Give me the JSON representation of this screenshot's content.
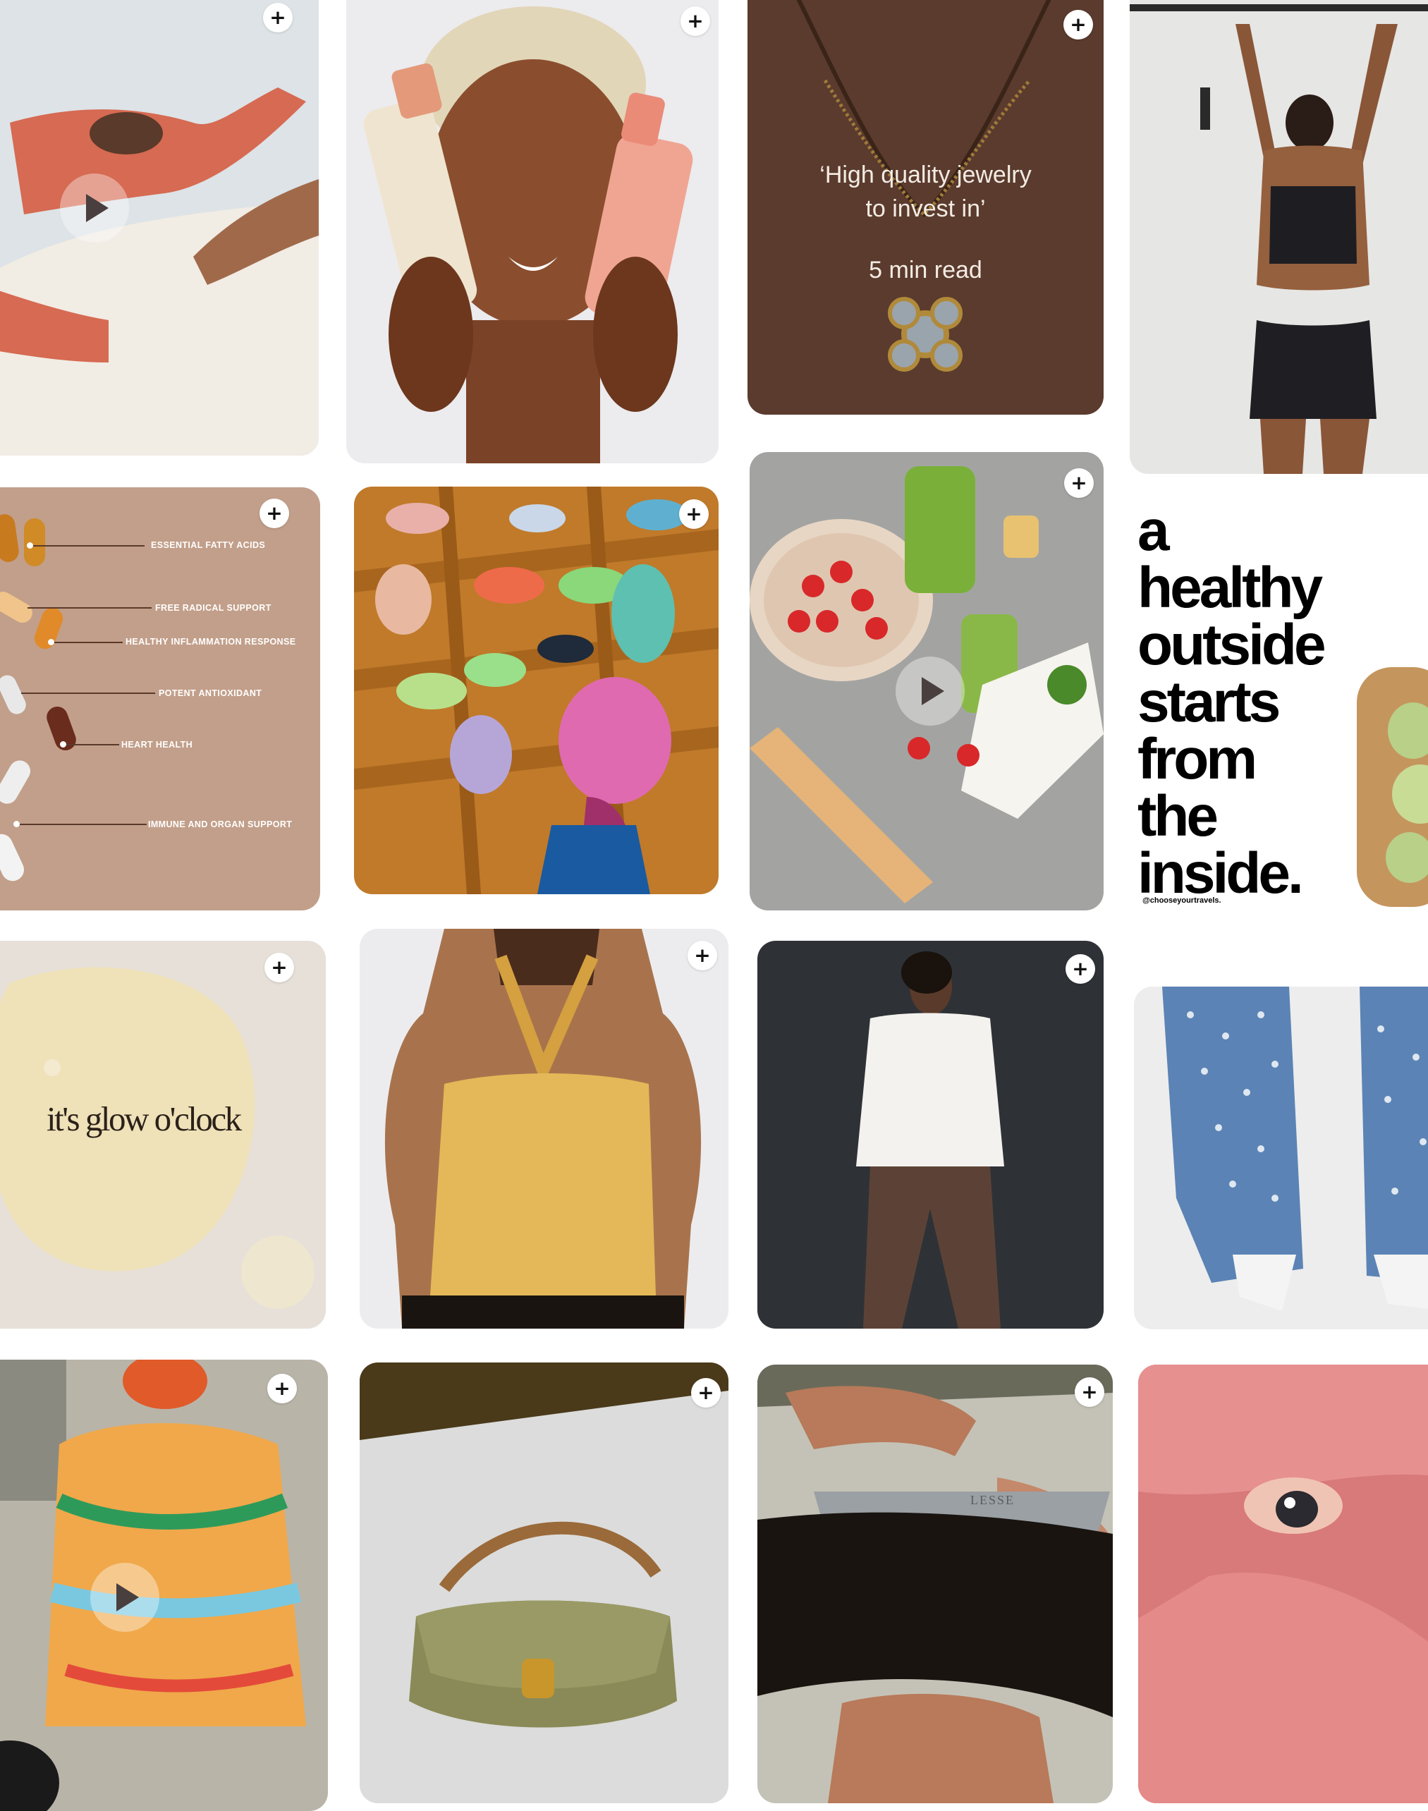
{
  "feed": {
    "save_label": "+",
    "pins": {
      "yoga": {
        "media": "video"
      },
      "skincare": {},
      "jewelry": {
        "headline": "‘High quality jewelry to invest in’",
        "read_time": "5 min read"
      },
      "fitness": {},
      "vitamins": {
        "labels": {
          "fatty_acids": "ESSENTIAL FATTY ACIDS",
          "radical": "FREE RADICAL SUPPORT",
          "inflammation": "HEALTHY INFLAMMATION RESPONSE",
          "antioxidant": "POTENT ANTIOXIDANT",
          "heart": "HEART HEALTH",
          "immune": "IMMUNE AND ORGAN SUPPORT"
        }
      },
      "shoes": {},
      "matcha": {
        "media": "video"
      },
      "healthy": {
        "lines": [
          "a",
          "healthy",
          "outside",
          "starts",
          "from",
          "the",
          "inside."
        ],
        "credit": "@chooseyourtravels."
      },
      "serum": {
        "text": "it's glow o'clock"
      },
      "halter": {},
      "menswear": {},
      "jeans": {},
      "knit": {
        "media": "video"
      },
      "handbag": {},
      "comb": {
        "brand": "LESSE"
      },
      "mask": {}
    }
  },
  "colors": {
    "background": "#ffffff",
    "save_button": "#ffffff",
    "jewelry_bg": "#5a3b2d",
    "vitamins_bg": "#c29f8a",
    "shoes_floor": "#c07a2a"
  }
}
